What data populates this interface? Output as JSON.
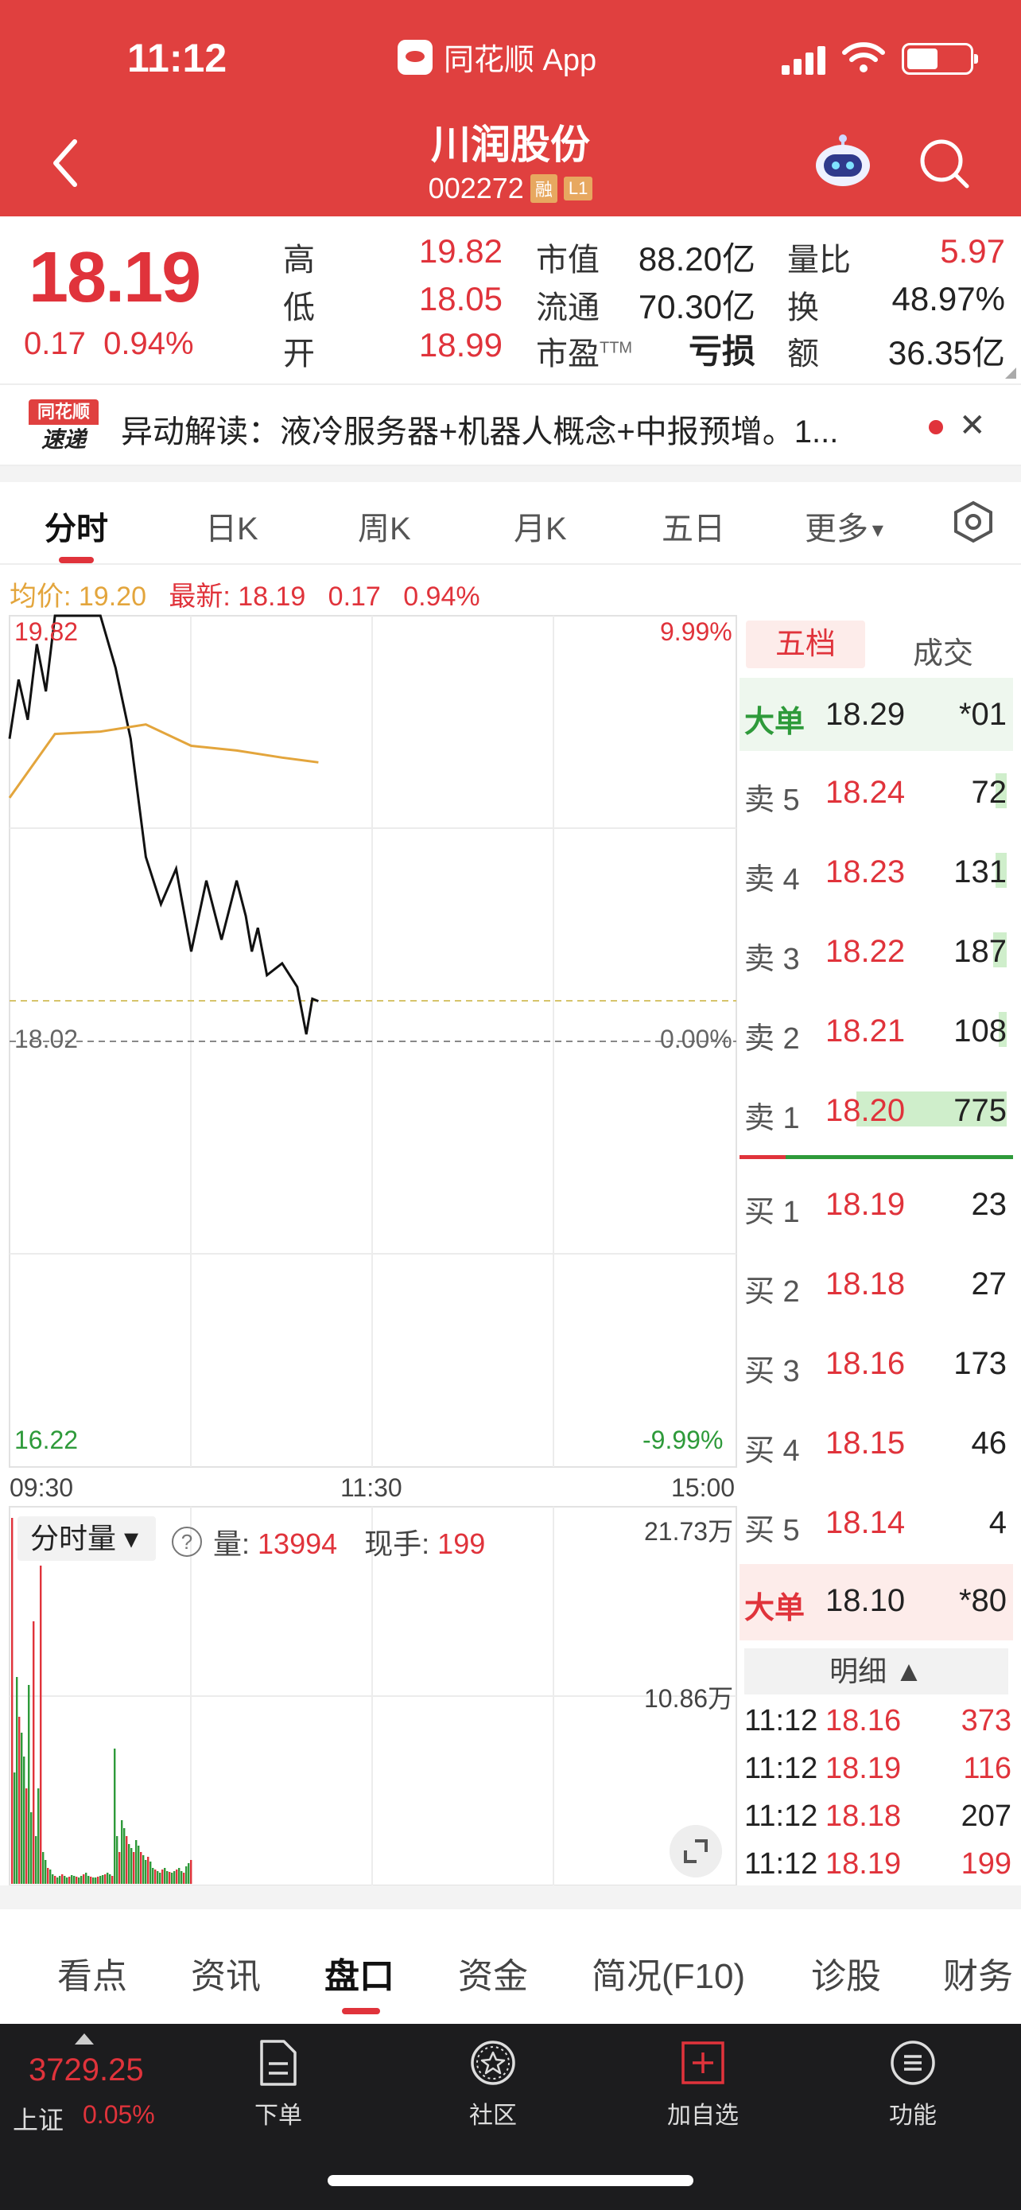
{
  "status": {
    "time": "11:12",
    "app": "同花顺 App"
  },
  "stock": {
    "name": "川润股份",
    "code": "002272",
    "badge_margin": "融",
    "badge_level": "L1"
  },
  "quote": {
    "price": "18.19",
    "change": "0.17",
    "change_pct": "0.94%",
    "high_label": "高",
    "high": "19.82",
    "low_label": "低",
    "low": "18.05",
    "open_label": "开",
    "open": "18.99",
    "mktcap_label": "市值",
    "mktcap": "88.20亿",
    "float_label": "流通",
    "float": "70.30亿",
    "pe_label": "市盈",
    "pe_sup": "TTM",
    "pe": "亏损",
    "volratio_label": "量比",
    "volratio": "5.97",
    "turnover_label": "换",
    "turnover": "48.97%",
    "amount_label": "额",
    "amount": "36.35亿"
  },
  "notice": {
    "logo_top": "同花顺",
    "logo_bottom": "速递",
    "text": "异动解读：液冷服务器+机器人概念+中报预增。1..."
  },
  "tabs": [
    "分时",
    "日K",
    "周K",
    "月K",
    "五日",
    "更多"
  ],
  "avg_line": {
    "avg_label": "均价: 19.20",
    "latest_label": "最新: 18.19",
    "change": "0.17",
    "pct": "0.94%"
  },
  "chart": {
    "y_top": "19.82",
    "y_mid": "18.02",
    "y_bottom": "16.22",
    "pct_top": "9.99%",
    "pct_mid": "0.00%",
    "pct_bottom": "-9.99%",
    "x_labels": [
      "09:30",
      "11:30",
      "15:00"
    ]
  },
  "chart_data": {
    "type": "line",
    "series": [
      {
        "x": [
          "09:30",
          "09:33",
          "09:36",
          "09:39",
          "09:42",
          "09:45",
          "09:48",
          "09:50",
          "09:52",
          "09:55",
          "09:58",
          "10:00",
          "10:05",
          "10:10",
          "10:15",
          "10:20",
          "10:25",
          "10:30",
          "10:35",
          "10:40",
          "10:45",
          "10:48",
          "10:50",
          "10:52",
          "10:55",
          "11:00",
          "11:05",
          "11:08",
          "11:10",
          "11:12"
        ],
        "values": [
          19.3,
          19.55,
          19.38,
          19.7,
          19.5,
          19.82,
          19.82,
          19.82,
          19.82,
          19.82,
          19.82,
          19.82,
          19.6,
          19.3,
          18.8,
          18.6,
          18.75,
          18.4,
          18.7,
          18.45,
          18.7,
          18.55,
          18.4,
          18.5,
          18.3,
          18.35,
          18.25,
          18.05,
          18.2,
          18.19
        ]
      },
      {
        "x": [
          "09:30",
          "09:45",
          "10:00",
          "10:15",
          "10:30",
          "10:45",
          "11:00",
          "11:12"
        ],
        "values": [
          19.05,
          19.32,
          19.33,
          19.36,
          19.27,
          19.25,
          19.22,
          19.2
        ]
      }
    ],
    "ylim": [
      16.22,
      19.82
    ],
    "prev_close": 18.02
  },
  "orderbook": {
    "tab_active": "五档",
    "tab_other": "成交",
    "big_sell": {
      "label": "大单",
      "price": "18.29",
      "vol": "*01"
    },
    "asks": [
      {
        "label": "卖 5",
        "price": "18.24",
        "vol": "72",
        "bar": 0.04
      },
      {
        "label": "卖 4",
        "price": "18.23",
        "vol": "131",
        "bar": 0.04
      },
      {
        "label": "卖 3",
        "price": "18.22",
        "vol": "187",
        "bar": 0.05
      },
      {
        "label": "卖 2",
        "price": "18.21",
        "vol": "108",
        "bar": 0.03
      },
      {
        "label": "卖 1",
        "price": "18.20",
        "vol": "775",
        "bar": 0.55
      }
    ],
    "bids": [
      {
        "label": "买 1",
        "price": "18.19",
        "vol": "23"
      },
      {
        "label": "买 2",
        "price": "18.18",
        "vol": "27"
      },
      {
        "label": "买 3",
        "price": "18.16",
        "vol": "173"
      },
      {
        "label": "买 4",
        "price": "18.15",
        "vol": "46"
      },
      {
        "label": "买 5",
        "price": "18.14",
        "vol": "4"
      }
    ],
    "big_buy": {
      "label": "大单",
      "price": "18.10",
      "vol": "*80"
    },
    "detail_label": "明细 ▲",
    "details": [
      {
        "time": "11:12",
        "price": "18.16",
        "vol": "373",
        "color": "#e0333b"
      },
      {
        "time": "11:12",
        "price": "18.19",
        "vol": "116",
        "color": "#e0333b"
      },
      {
        "time": "11:12",
        "price": "18.18",
        "vol": "207",
        "color": "#222222"
      },
      {
        "time": "11:12",
        "price": "18.19",
        "vol": "199",
        "color": "#e0333b"
      }
    ]
  },
  "volume": {
    "dropdown": "分时量 ▾",
    "help": "?",
    "vol_label": "量:",
    "vol_value": "13994",
    "hand_label": "现手:",
    "hand_value": "199",
    "y_top": "21.73万",
    "y_mid": "10.86万"
  },
  "bottom_tabs": [
    "看点",
    "资讯",
    "盘口",
    "资金",
    "简况(F10)",
    "诊股",
    "财务"
  ],
  "bottom_nav": {
    "index_price": "3729.25",
    "index_name": "上证",
    "index_pct": "0.05%",
    "items": [
      "下单",
      "社区",
      "加自选",
      "功能"
    ]
  },
  "colors": {
    "brand": "#e0403f",
    "up": "#e0333b",
    "down": "#2e9a3a",
    "avg": "#e3a53c"
  }
}
